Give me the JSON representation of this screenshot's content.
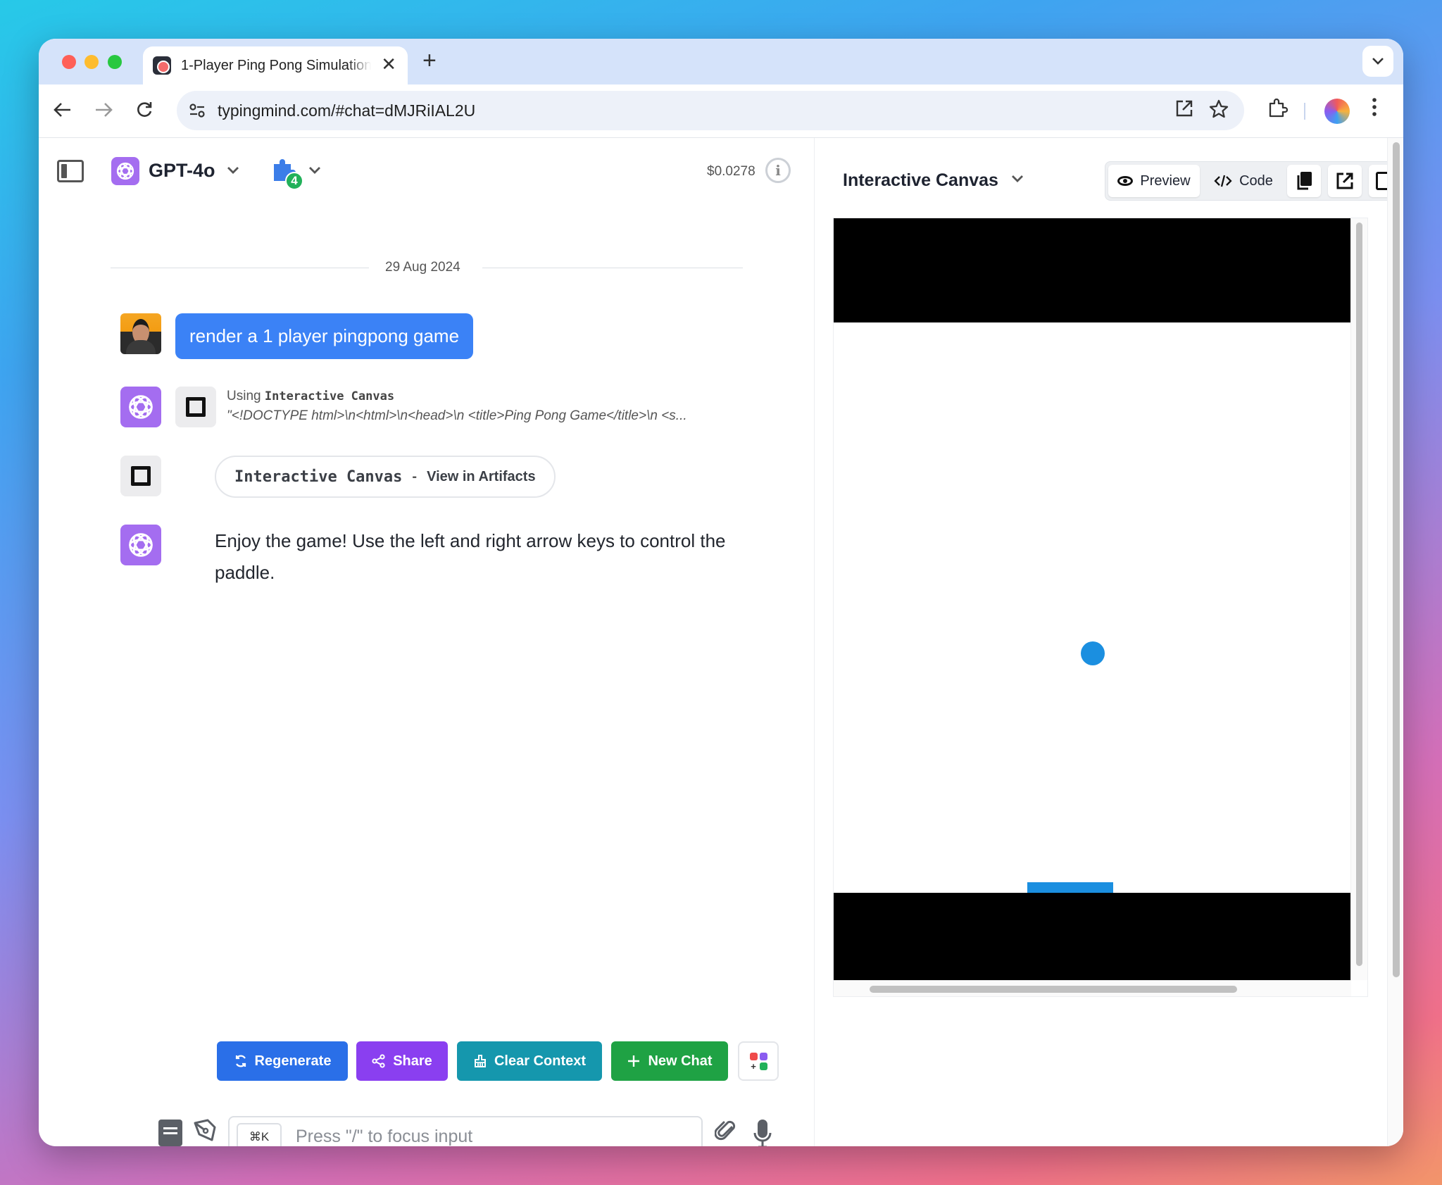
{
  "browser": {
    "tab_title": "1-Player Ping Pong Simulation",
    "tab_close": "✕",
    "new_tab": "+",
    "url": "typingmind.com/#chat=dMJRiIAL2U"
  },
  "header": {
    "model_name": "GPT-4o",
    "plugin_count": "4",
    "cost": "$0.0278",
    "info_glyph": "i"
  },
  "chat": {
    "date": "29 Aug 2024",
    "user_message": "render a 1 player pingpong game",
    "tool_using_prefix": "Using",
    "tool_name": "Interactive Canvas",
    "tool_code_preview": "\"<!DOCTYPE html>\\n<html>\\n<head>\\n <title>Ping Pong Game</title>\\n <s...",
    "artifact_name": "Interactive Canvas",
    "artifact_separator": "-",
    "artifact_link": "View in Artifacts",
    "assistant_message": "Enjoy the game! Use the left and right arrow keys to control the paddle."
  },
  "actions": {
    "regenerate": "Regenerate",
    "share": "Share",
    "clear_context": "Clear Context",
    "new_chat": "New Chat"
  },
  "input": {
    "shortcut": "⌘K",
    "placeholder": "Press \"/\" to focus input"
  },
  "artifact_panel": {
    "title": "Interactive Canvas",
    "preview_label": "Preview",
    "code_label": "Code"
  },
  "colors": {
    "primary_blue": "#3b82f6",
    "model_purple": "#a46df0",
    "regenerate": "#2a6fe8",
    "share": "#8a3ff0",
    "clear_context": "#1597ad",
    "new_chat": "#1fa244",
    "game_ball": "#1b8fe0"
  },
  "icons": {
    "back": "arrow-left-icon",
    "forward": "arrow-right-icon",
    "reload": "reload-icon",
    "site_settings": "tune-icon",
    "open_external": "open-external-icon",
    "bookmark": "star-icon",
    "extensions": "puzzle-icon",
    "menu": "kebab-icon"
  }
}
